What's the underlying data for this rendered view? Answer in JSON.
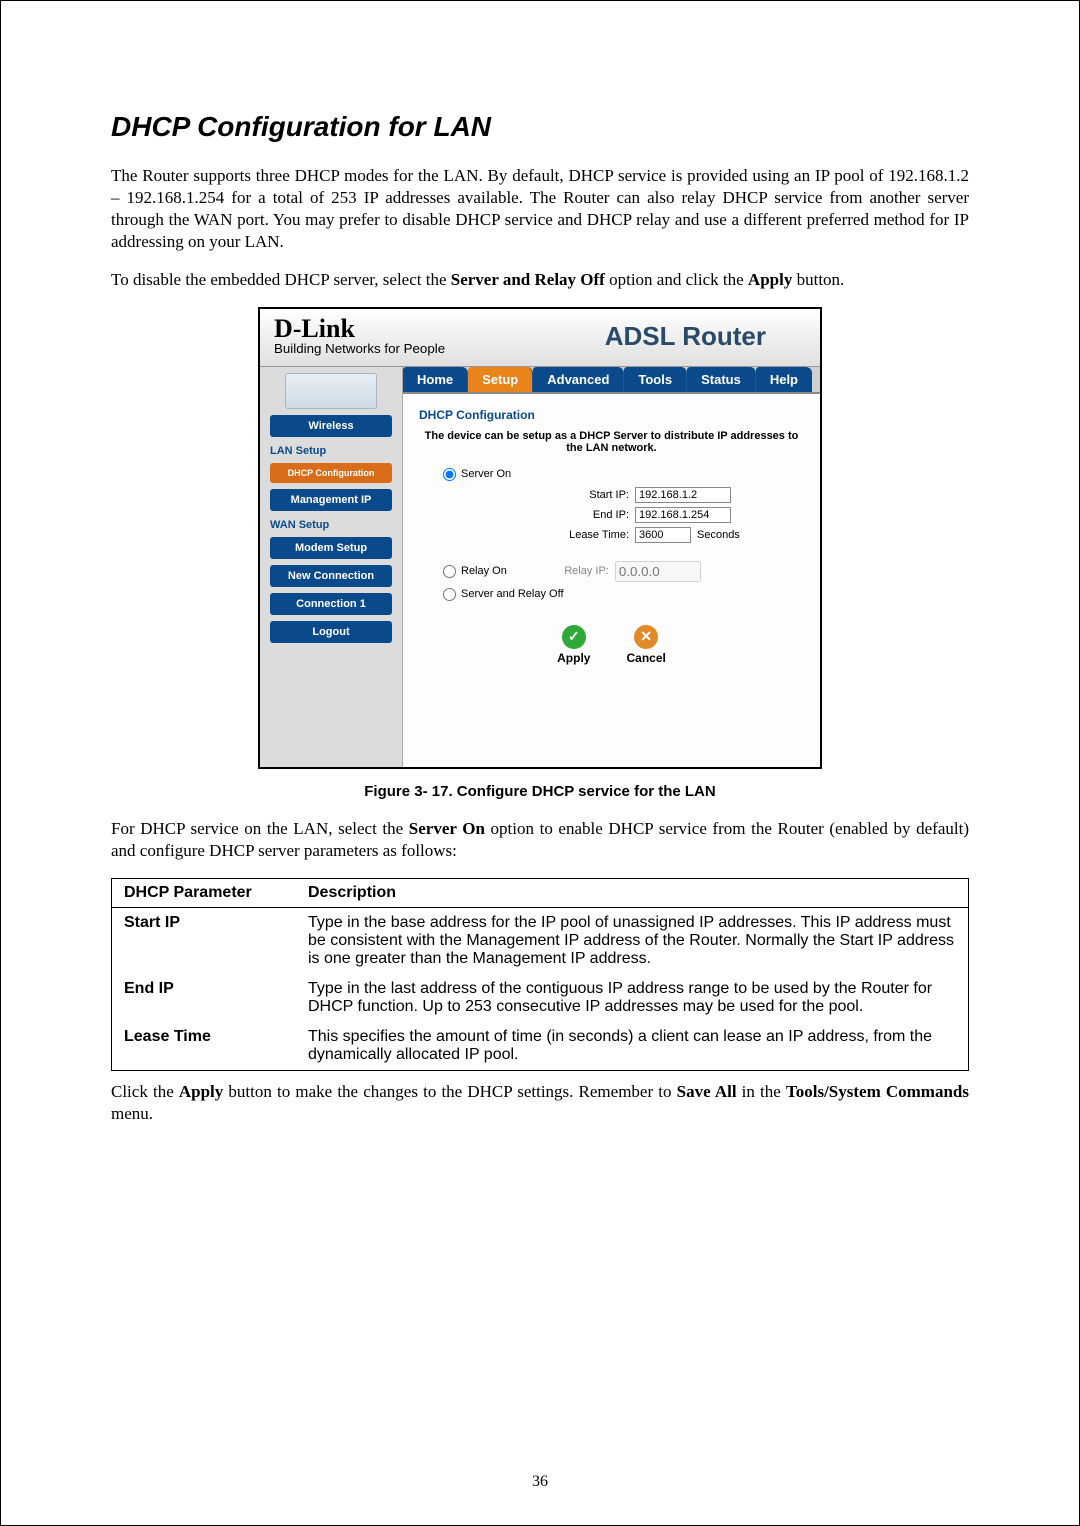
{
  "page_number": "36",
  "title": "DHCP Configuration for LAN",
  "para1": "The Router supports three DHCP modes for the LAN. By default, DHCP service is provided using an IP pool of 192.168.1.2 – 192.168.1.254 for a total of 253 IP addresses available. The Router can also relay DHCP service from another server through the WAN port. You may prefer to disable DHCP service and DHCP relay and use a different preferred method for IP addressing on your LAN.",
  "para2_prefix": "To disable the embedded DHCP server, select the ",
  "para2_bold1": "Server and Relay Off",
  "para2_mid": " option and click the ",
  "para2_bold2": "Apply",
  "para2_suffix": " button.",
  "fig": {
    "brand": "D-Link",
    "brand_sub": "Building Networks for People",
    "router_title": "ADSL Router",
    "tabs": [
      "Home",
      "Setup",
      "Advanced",
      "Tools",
      "Status",
      "Help"
    ],
    "active_tab_index": 1,
    "sidebar": {
      "wireless": "Wireless",
      "lan_setup": "LAN Setup",
      "dhcp_config": "DHCP Configuration",
      "management_ip": "Management IP",
      "wan_setup": "WAN Setup",
      "modem_setup": "Modem Setup",
      "new_connection": "New Connection",
      "connection1": "Connection 1",
      "logout": "Logout"
    },
    "form": {
      "title": "DHCP Configuration",
      "desc": "The device can be setup as a DHCP Server to distribute IP addresses to the LAN network.",
      "server_on": "Server On",
      "start_ip_label": "Start IP:",
      "start_ip": "192.168.1.2",
      "end_ip_label": "End IP:",
      "end_ip": "192.168.1.254",
      "lease_label": "Lease Time:",
      "lease": "3600",
      "lease_unit": "Seconds",
      "relay_on": "Relay On",
      "relay_ip_label": "Relay IP:",
      "relay_ip_placeholder": "0.0.0.0",
      "server_relay_off": "Server and Relay Off",
      "apply": "Apply",
      "cancel": "Cancel"
    }
  },
  "figcap": "Figure 3- 17. Configure DHCP service for the LAN",
  "para3_prefix": "For DHCP service on the LAN, select the ",
  "para3_bold1": "Server On",
  "para3_suffix": " option to enable DHCP service from the Router (enabled by default) and configure DHCP server parameters as follows:",
  "table": {
    "h1": "DHCP Parameter",
    "h2": "Description",
    "rows": [
      {
        "p": "Start IP",
        "d": "Type in the base address for the IP pool of unassigned IP addresses. This IP address must be consistent with the Management IP address of the Router. Normally the Start IP address is one greater than the Management IP address."
      },
      {
        "p": "End IP",
        "d": "Type in the last address of the contiguous IP address range to be used by the Router for DHCP function. Up to 253 consecutive IP addresses may be used for the pool."
      },
      {
        "p": "Lease Time",
        "d": "This specifies the amount of time (in seconds) a client can lease an IP address, from the dynamically allocated IP pool."
      }
    ]
  },
  "para4_prefix": "Click the ",
  "para4_bold1": "Apply",
  "para4_mid": " button to make the changes to the DHCP settings. Remember to ",
  "para4_bold2": "Save All",
  "para4_mid2": " in the ",
  "para4_bold3": "Tools/System Commands",
  "para4_suffix": " menu."
}
